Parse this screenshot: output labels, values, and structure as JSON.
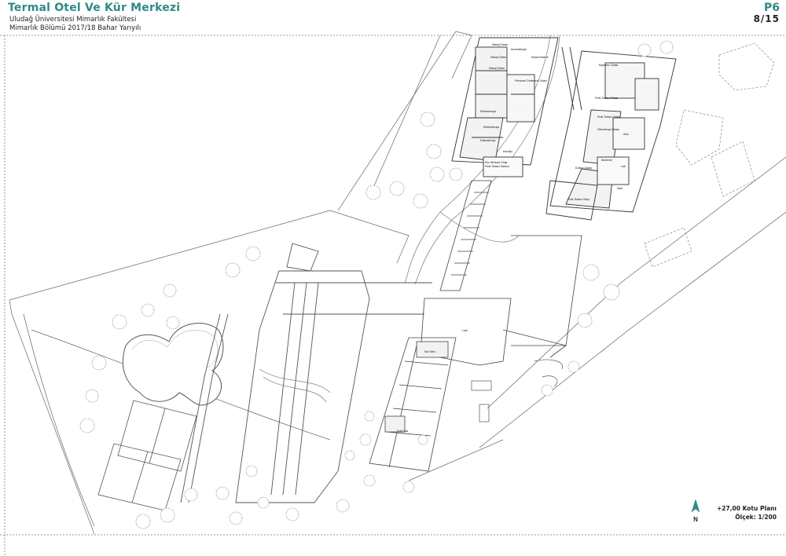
{
  "header": {
    "title": "Termal Otel Ve Kür Merkezi",
    "subtitle_line1": "Uludağ Üniversitesi Mimarlık Fakültesi",
    "subtitle_line2": "Mimarlık Bölümü 2017/18 Bahar Yarıyılı",
    "sheet_code": "P6",
    "sheet_number": "8/15"
  },
  "plan_info": {
    "level_label": "+27,00 Kotu Planı",
    "scale_label": "Ölçek: 1/200",
    "north_letter": "N"
  },
  "room_labels": {
    "masaj1": "Masaj Odası",
    "aromaterapi": "Aromaterapi",
    "masaj2": "Masaj Odası",
    "kisisel_bakim": "Kişisel Bakım",
    "masaj3": "Masaj Odası",
    "personel": "Personel Dinlenme Odası",
    "elektroterapi": "Elektroterapi",
    "elektroterapi2": "Elektroterapi",
    "dalmaterapi": "Dalmaterapi",
    "kardiyo": "Kardiyo",
    "kur_giris": "Kür Merkezi Girişi",
    "fizik_terapi_salonu": "Fizik Tedavi Salonu",
    "egzersiz": "Egzersiz Odası",
    "fizik_tedavi_odasi": "Fizik Tedavi Odası",
    "fizik_tedavi_odasi2": "Fizik Tedavi Odası",
    "hidroterapi": "Hidroterapi Odası",
    "avlu": "Avlu",
    "doktor": "Doktor Odası",
    "bekleme": "Bekleme",
    "lab": "Lab",
    "kafe": "Kafe",
    "fizik_giris": "Fizik Tedavi Girişi",
    "lobi": "Lobi",
    "kat_ofisi": "Kat Ofisi",
    "suit_oda": "Suit Oda"
  },
  "colors": {
    "accent": "#2f8a86",
    "line": "#555555",
    "water": "#ffffff"
  }
}
